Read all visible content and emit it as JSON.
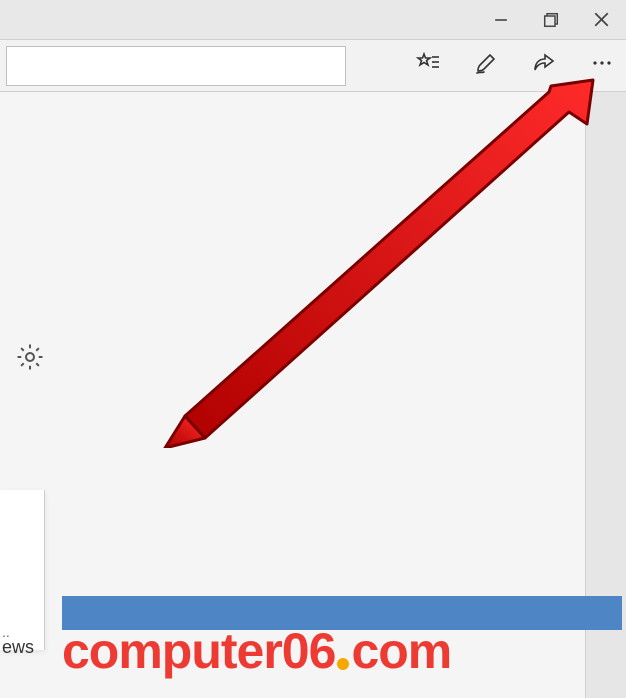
{
  "window": {
    "minimize_tooltip": "Minimize",
    "maximize_tooltip": "Restore",
    "close_tooltip": "Close"
  },
  "toolbar": {
    "address_value": "",
    "favorites_tooltip": "Add to favorites or reading list",
    "notes_tooltip": "Add notes",
    "share_tooltip": "Share",
    "more_tooltip": "Settings and more"
  },
  "page": {
    "gear_tooltip": "Settings",
    "card_text": "..",
    "news_label": "ews"
  },
  "watermark": {
    "left": "computer06",
    "right": "com"
  }
}
